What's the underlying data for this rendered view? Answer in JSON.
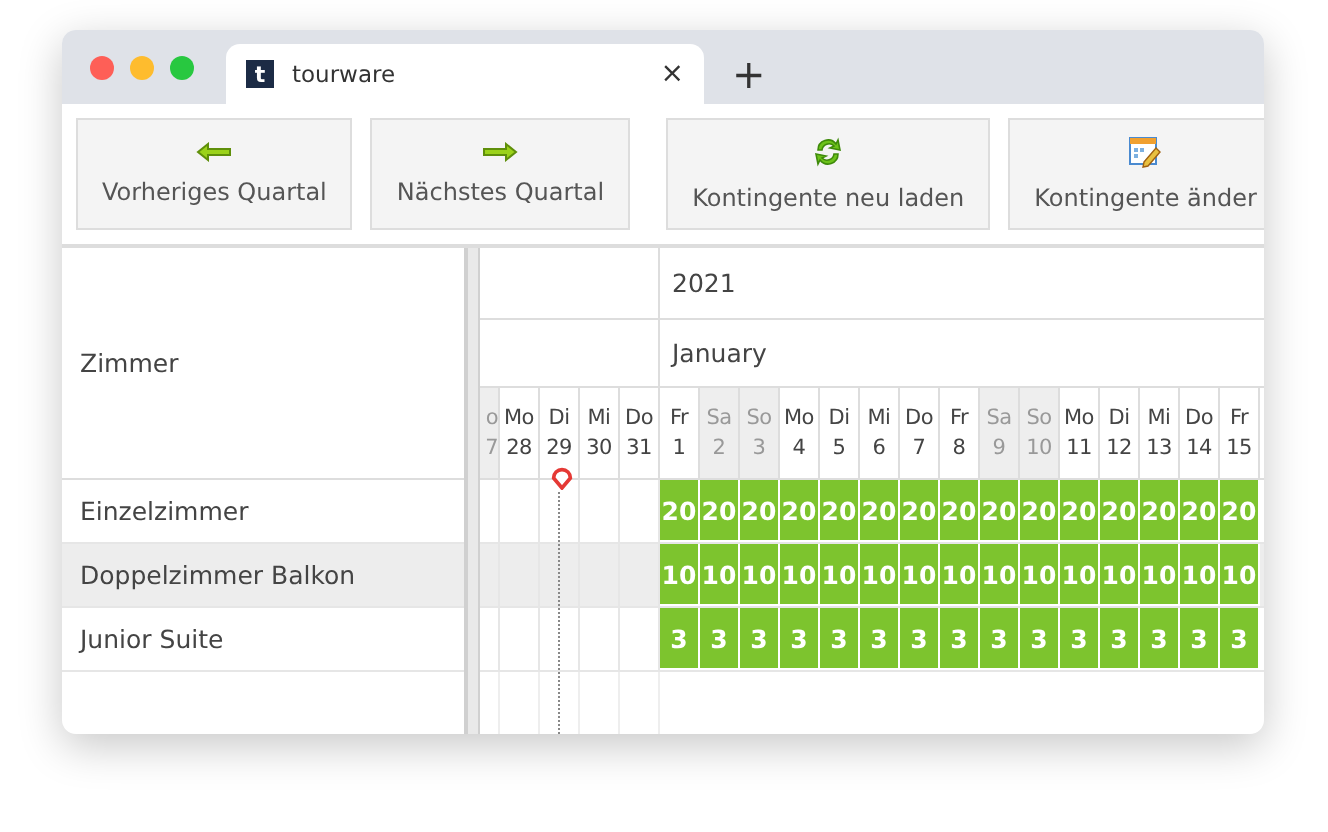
{
  "browser": {
    "favicon": "t",
    "tab_title": "tourware",
    "close": "×",
    "new_tab": "+"
  },
  "toolbar": [
    {
      "label": "Vorheriges Quartal",
      "kind": "prev"
    },
    {
      "label": "Nächstes Quartal",
      "kind": "next"
    },
    {
      "label": "Kontingente neu laden",
      "kind": "reload"
    },
    {
      "label": "Kontingente änder",
      "kind": "edit"
    }
  ],
  "grid": {
    "header": "Zimmer",
    "year": "2021",
    "month": "January",
    "days": [
      {
        "dow": "o",
        "day": "7",
        "weekend": true,
        "today": false
      },
      {
        "dow": "Mo",
        "day": "28",
        "weekend": false,
        "today": false
      },
      {
        "dow": "Di",
        "day": "29",
        "weekend": false,
        "today": true
      },
      {
        "dow": "Mi",
        "day": "30",
        "weekend": false,
        "today": false
      },
      {
        "dow": "Do",
        "day": "31",
        "weekend": false,
        "today": false
      },
      {
        "dow": "Fr",
        "day": "1",
        "weekend": false,
        "today": false
      },
      {
        "dow": "Sa",
        "day": "2",
        "weekend": true,
        "today": false
      },
      {
        "dow": "So",
        "day": "3",
        "weekend": true,
        "today": false
      },
      {
        "dow": "Mo",
        "day": "4",
        "weekend": false,
        "today": false
      },
      {
        "dow": "Di",
        "day": "5",
        "weekend": false,
        "today": false
      },
      {
        "dow": "Mi",
        "day": "6",
        "weekend": false,
        "today": false
      },
      {
        "dow": "Do",
        "day": "7",
        "weekend": false,
        "today": false
      },
      {
        "dow": "Fr",
        "day": "8",
        "weekend": false,
        "today": false
      },
      {
        "dow": "Sa",
        "day": "9",
        "weekend": true,
        "today": false
      },
      {
        "dow": "So",
        "day": "10",
        "weekend": true,
        "today": false
      },
      {
        "dow": "Mo",
        "day": "11",
        "weekend": false,
        "today": false
      },
      {
        "dow": "Di",
        "day": "12",
        "weekend": false,
        "today": false
      },
      {
        "dow": "Mi",
        "day": "13",
        "weekend": false,
        "today": false
      },
      {
        "dow": "Do",
        "day": "14",
        "weekend": false,
        "today": false
      },
      {
        "dow": "Fr",
        "day": "15",
        "weekend": false,
        "today": false
      }
    ],
    "rooms": [
      {
        "name": "Einzelzimmer",
        "highlighted": false,
        "values": [
          "20",
          "20",
          "20",
          "20",
          "20",
          "20",
          "20",
          "20",
          "20",
          "20",
          "20",
          "20",
          "20",
          "20",
          "20"
        ]
      },
      {
        "name": "Doppelzimmer Balkon",
        "highlighted": true,
        "values": [
          "10",
          "10",
          "10",
          "10",
          "10",
          "10",
          "10",
          "10",
          "10",
          "10",
          "10",
          "10",
          "10",
          "10",
          "10"
        ]
      },
      {
        "name": "Junior Suite",
        "highlighted": false,
        "values": [
          "3",
          "3",
          "3",
          "3",
          "3",
          "3",
          "3",
          "3",
          "3",
          "3",
          "3",
          "3",
          "3",
          "3",
          "3"
        ]
      }
    ]
  }
}
